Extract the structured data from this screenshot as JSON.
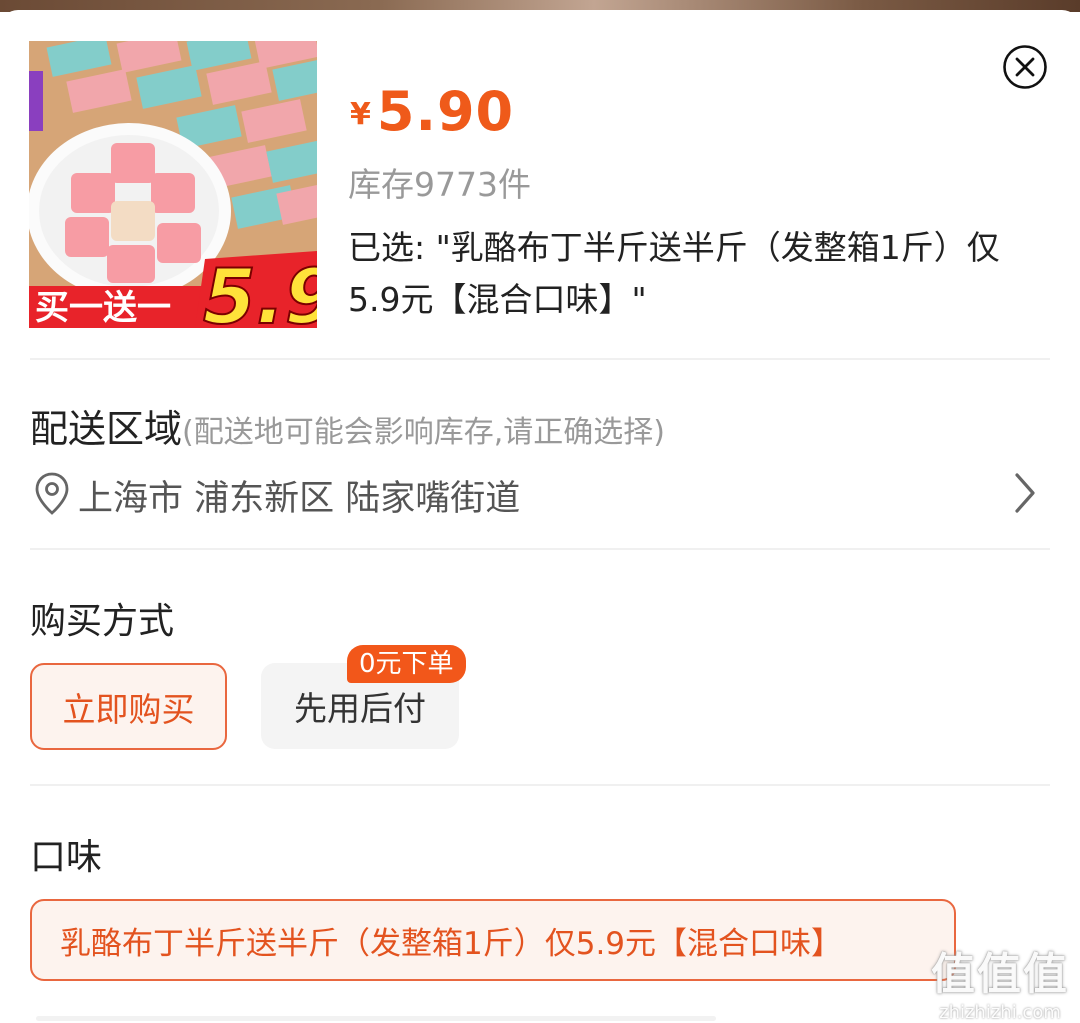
{
  "product": {
    "image_alt": "乳酪布丁",
    "banner_text": "买一送一",
    "banner_price": "5.9",
    "price_symbol": "¥",
    "price": "5.90",
    "stock": "库存9773件",
    "selected_label": "已选: \"乳酪布丁半斤送半斤（发整箱1斤）仅5.9元【混合口味】\""
  },
  "delivery": {
    "title": "配送区域",
    "hint": "(配送地可能会影响库存,请正确选择)",
    "address": "上海市 浦东新区 陆家嘴街道"
  },
  "purchase": {
    "title": "购买方式",
    "buy_now": "立即购买",
    "pay_later": "先用后付",
    "pay_later_badge": "0元下单"
  },
  "flavor": {
    "title": "口味",
    "selected_option": "乳酪布丁半斤送半斤（发整箱1斤）仅5.9元【混合口味】"
  },
  "watermark": {
    "mark": "值值值",
    "url": "zhizhizhi.com"
  },
  "colors": {
    "accent": "#ef5a1a",
    "accent_border": "#e9673f",
    "accent_bg": "#fdf3ee",
    "muted_text": "#999999"
  },
  "icons": {
    "close": "close-circle-icon",
    "location": "location-pin-icon",
    "chevron": "chevron-right-icon"
  }
}
